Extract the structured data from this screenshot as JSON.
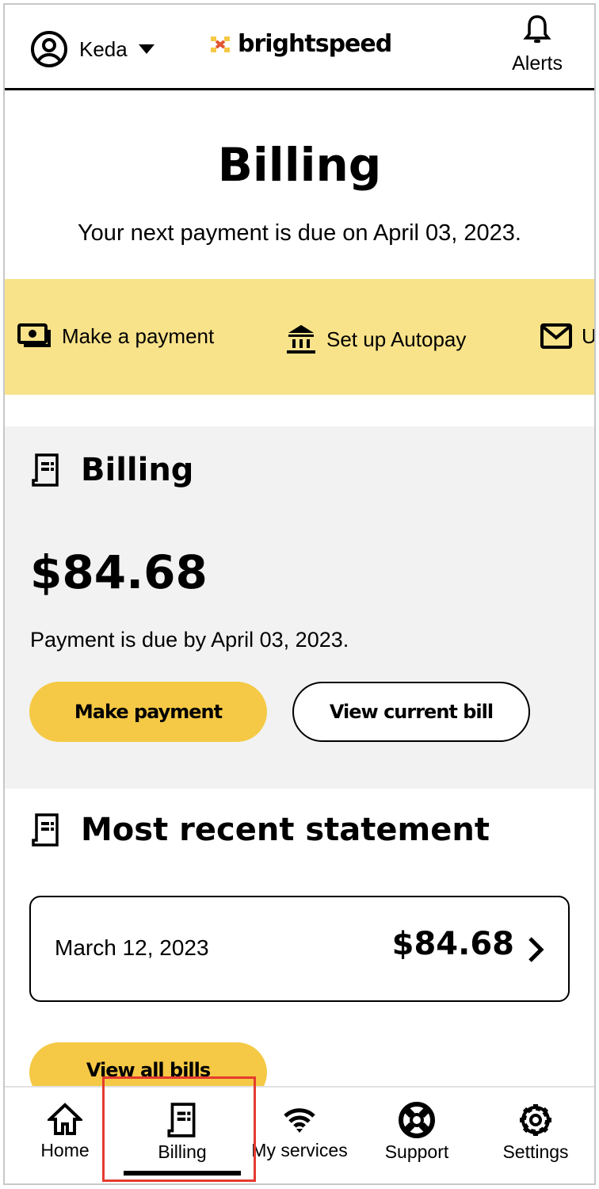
{
  "header": {
    "user_name": "Keda",
    "logo_text": "brightspeed",
    "alerts_label": "Alerts"
  },
  "page": {
    "title": "Billing",
    "subtitle": "Your next payment is due on April 03, 2023."
  },
  "quick_actions": [
    {
      "label": "Make a payment",
      "icon": "cash-icon"
    },
    {
      "label": "Set up Autopay",
      "icon": "bank-icon"
    },
    {
      "label": "U",
      "icon": "mail-icon"
    }
  ],
  "billing": {
    "heading": "Billing",
    "amount": "$84.68",
    "due_text": "Payment is due by April 03, 2023.",
    "make_payment": "Make payment",
    "view_current_bill": "View current bill"
  },
  "statement": {
    "heading": "Most recent statement",
    "date": "March 12, 2023",
    "amount": "$84.68",
    "view_all": "View all bills"
  },
  "nav": [
    {
      "label": "Home"
    },
    {
      "label": "Billing",
      "active": true
    },
    {
      "label": "My services"
    },
    {
      "label": "Support"
    },
    {
      "label": "Settings"
    }
  ],
  "colors": {
    "accent_yellow": "#f5c945",
    "band_yellow": "#f9e38a",
    "section_gray": "#f1f2f1",
    "highlight": "#e53a2f"
  }
}
